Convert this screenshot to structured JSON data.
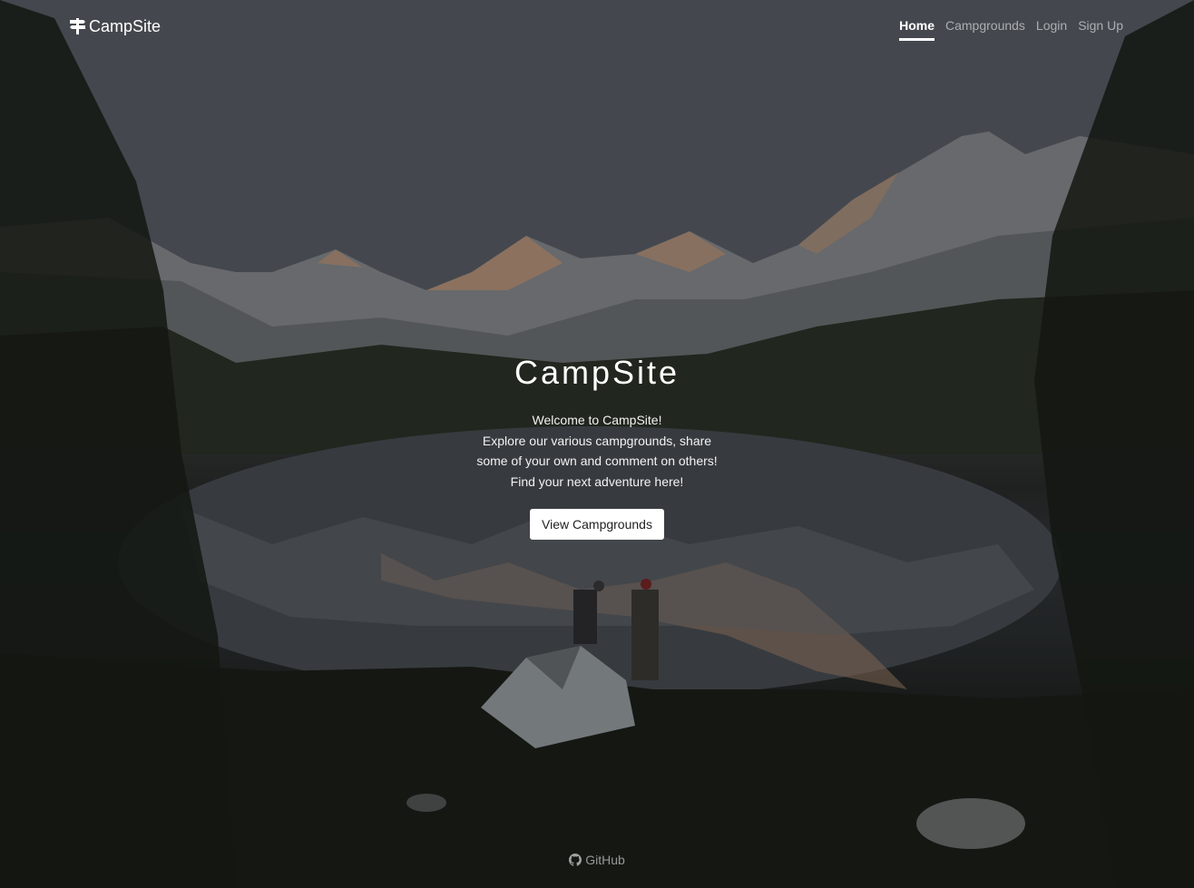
{
  "brand": {
    "name": "CampSite",
    "icon": "signpost-icon"
  },
  "nav": {
    "links": [
      {
        "label": "Home",
        "active": true
      },
      {
        "label": "Campgrounds",
        "active": false
      },
      {
        "label": "Login",
        "active": false
      },
      {
        "label": "Sign Up",
        "active": false
      }
    ]
  },
  "hero": {
    "title": "CampSite",
    "lines": [
      "Welcome to CampSite!",
      "Explore our various campgrounds, share",
      "some of your own and comment on others!",
      "Find your next adventure here!"
    ],
    "button_label": "View Campgrounds"
  },
  "footer": {
    "link_label": "GitHub",
    "icon": "github-icon"
  }
}
